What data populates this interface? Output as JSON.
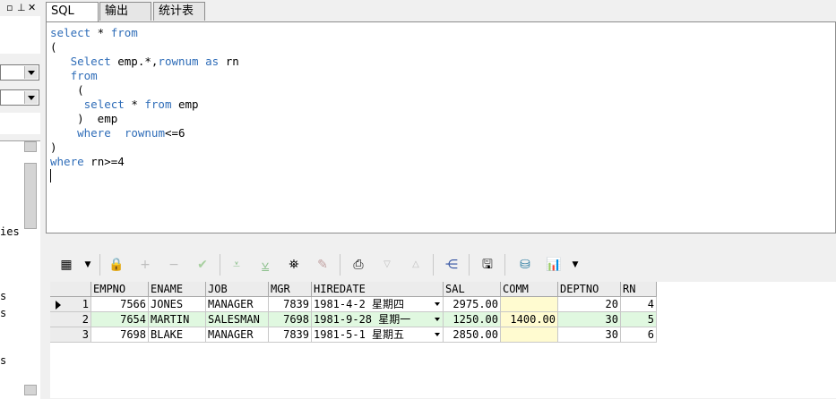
{
  "left_panel": {
    "pin_label": "-",
    "text_1": "ies",
    "text_2": "s",
    "text_3": "s",
    "text_4": "s"
  },
  "tabs": [
    "SQL",
    "输出",
    "统计表"
  ],
  "editor": {
    "lines": [
      [
        {
          "t": "select",
          "k": 1
        },
        {
          "t": " * ",
          "k": 0
        },
        {
          "t": "from",
          "k": 1
        }
      ],
      [
        {
          "t": "(",
          "k": 0
        }
      ],
      [
        {
          "t": "   ",
          "k": 0
        },
        {
          "t": "Select",
          "k": 1
        },
        {
          "t": " emp.*,",
          "k": 0
        },
        {
          "t": "rownum",
          "k": 1
        },
        {
          "t": " ",
          "k": 0
        },
        {
          "t": "as",
          "k": 1
        },
        {
          "t": " rn",
          "k": 0
        }
      ],
      [
        {
          "t": "   ",
          "k": 0
        },
        {
          "t": "from",
          "k": 1
        }
      ],
      [
        {
          "t": "    (",
          "k": 0
        }
      ],
      [
        {
          "t": "     ",
          "k": 0
        },
        {
          "t": "select",
          "k": 1
        },
        {
          "t": " * ",
          "k": 0
        },
        {
          "t": "from",
          "k": 1
        },
        {
          "t": " emp",
          "k": 0
        }
      ],
      [
        {
          "t": "    )  emp",
          "k": 0
        }
      ],
      [
        {
          "t": "    ",
          "k": 0
        },
        {
          "t": "where",
          "k": 1
        },
        {
          "t": "  ",
          "k": 0
        },
        {
          "t": "rownum",
          "k": 1
        },
        {
          "t": "<=6",
          "k": 0
        }
      ],
      [
        {
          "t": ")",
          "k": 0
        }
      ],
      [
        {
          "t": "where",
          "k": 1
        },
        {
          "t": " rn>=4",
          "k": 0
        }
      ]
    ]
  },
  "toolbar": {
    "icons": [
      "grid-icon",
      "dropdown-icon",
      "lock-icon",
      "add-icon",
      "remove-icon",
      "check-icon",
      "next-icon",
      "last-icon",
      "find-icon",
      "clear-icon",
      "export-icon",
      "down-icon",
      "up-icon",
      "tree-icon",
      "save-icon",
      "db-icon",
      "chart-icon",
      "dropdown-icon"
    ]
  },
  "grid": {
    "columns": [
      "EMPNO",
      "ENAME",
      "JOB",
      "MGR",
      "HIREDATE",
      "SAL",
      "COMM",
      "DEPTNO",
      "RN"
    ],
    "rows": [
      {
        "no": "1",
        "empno": "7566",
        "ename": "JONES",
        "job": "MANAGER",
        "mgr": "7839",
        "hiredate": "1981-4-2 星期四",
        "sal": "2975.00",
        "comm": "",
        "deptno": "20",
        "rn": "4"
      },
      {
        "no": "2",
        "empno": "7654",
        "ename": "MARTIN",
        "job": "SALESMAN",
        "mgr": "7698",
        "hiredate": "1981-9-28 星期一",
        "sal": "1250.00",
        "comm": "1400.00",
        "deptno": "30",
        "rn": "5"
      },
      {
        "no": "3",
        "empno": "7698",
        "ename": "BLAKE",
        "job": "MANAGER",
        "mgr": "7839",
        "hiredate": "1981-5-1 星期五",
        "sal": "2850.00",
        "comm": "",
        "deptno": "30",
        "rn": "6"
      }
    ]
  },
  "colors": {
    "keyword": "#2f6db8",
    "grid_green": "#e0f8e0",
    "grid_yellow": "#fffbd0"
  }
}
